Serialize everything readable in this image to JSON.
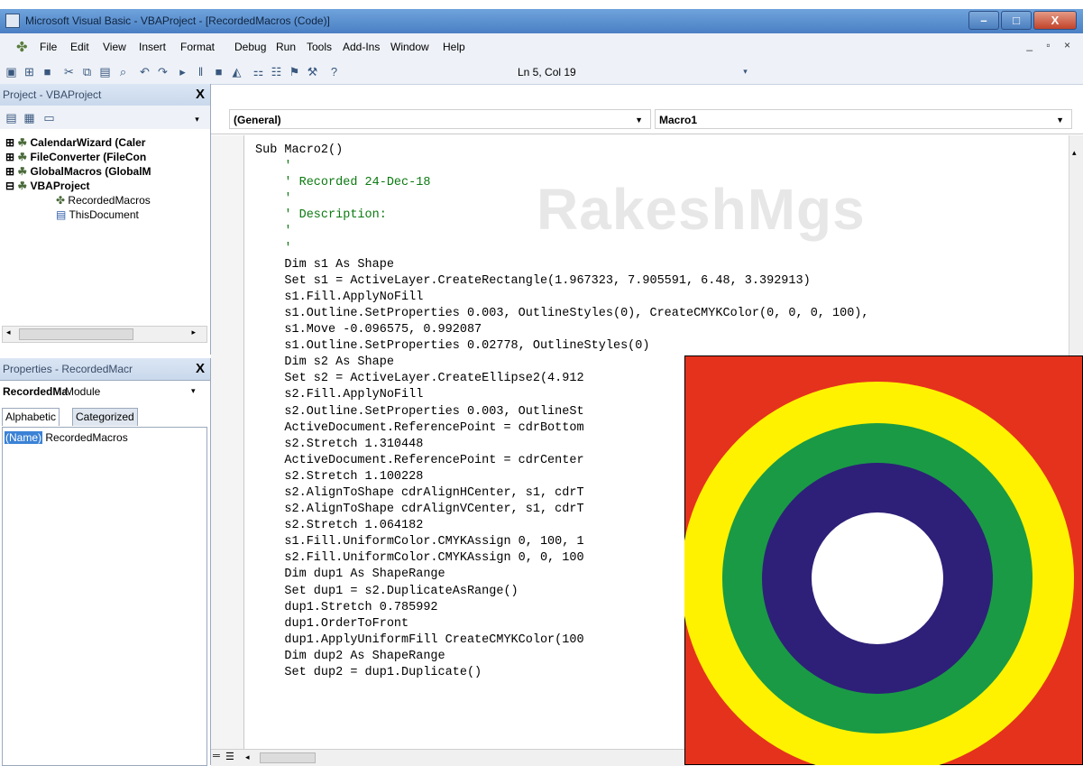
{
  "window": {
    "title": "Microsoft Visual Basic - VBAProject - [RecordedMacros (Code)]",
    "buttons": {
      "minimize": "–",
      "maximize": "□",
      "close": "X"
    }
  },
  "menu": {
    "items": [
      "File",
      "Edit",
      "View",
      "Insert",
      "Format",
      "Debug",
      "Run",
      "Tools",
      "Add-Ins",
      "Window",
      "Help"
    ],
    "mdi_controls": "_ ▫ ×"
  },
  "toolbar": {
    "cursor_position": "Ln 5, Col 19"
  },
  "project_explorer": {
    "title": "Project - VBAProject",
    "close": "X",
    "tree": [
      {
        "label": "CalendarWizard (Caler",
        "bold": true
      },
      {
        "label": "FileConverter (FileCon",
        "bold": true
      },
      {
        "label": "GlobalMacros (GlobalM",
        "bold": true
      },
      {
        "label": "VBAProject",
        "bold": true
      },
      {
        "label": "RecordedMacros",
        "bold": false
      },
      {
        "label": "ThisDocument",
        "bold": false
      }
    ]
  },
  "properties": {
    "title": "Properties - RecordedMacr",
    "close": "X",
    "object_name": "RecordedMa",
    "object_type": "Module",
    "tabs": [
      "Alphabetic",
      "Categorized"
    ],
    "rows": [
      {
        "name": "(Name)",
        "value": "RecordedMacros"
      }
    ]
  },
  "code_window": {
    "object_combo": "(General)",
    "procedure_combo": "Macro1",
    "watermark": "RakeshMgs",
    "lines": [
      {
        "text": "Sub Macro2()",
        "comment": false
      },
      {
        "text": "    '",
        "comment": true
      },
      {
        "text": "    ' Recorded 24-Dec-18",
        "comment": true
      },
      {
        "text": "    '",
        "comment": true
      },
      {
        "text": "    ' Description:",
        "comment": true
      },
      {
        "text": "    '",
        "comment": true
      },
      {
        "text": "    '",
        "comment": true
      },
      {
        "text": "    Dim s1 As Shape",
        "comment": false
      },
      {
        "text": "    Set s1 = ActiveLayer.CreateRectangle(1.967323, 7.905591, 6.48, 3.392913)",
        "comment": false
      },
      {
        "text": "    s1.Fill.ApplyNoFill",
        "comment": false
      },
      {
        "text": "    s1.Outline.SetProperties 0.003, OutlineStyles(0), CreateCMYKColor(0, 0, 0, 100),",
        "comment": false
      },
      {
        "text": "    s1.Move -0.096575, 0.992087",
        "comment": false
      },
      {
        "text": "    s1.Outline.SetProperties 0.02778, OutlineStyles(0)",
        "comment": false
      },
      {
        "text": "    Dim s2 As Shape",
        "comment": false
      },
      {
        "text": "    Set s2 = ActiveLayer.CreateEllipse2(4.912",
        "comment": false
      },
      {
        "text": "    s2.Fill.ApplyNoFill",
        "comment": false
      },
      {
        "text": "    s2.Outline.SetProperties 0.003, OutlineSt",
        "comment": false
      },
      {
        "text": "    ActiveDocument.ReferencePoint = cdrBottom",
        "comment": false
      },
      {
        "text": "    s2.Stretch 1.310448",
        "comment": false
      },
      {
        "text": "    ActiveDocument.ReferencePoint = cdrCenter",
        "comment": false
      },
      {
        "text": "    s2.Stretch 1.100228",
        "comment": false
      },
      {
        "text": "    s2.AlignToShape cdrAlignHCenter, s1, cdrT",
        "comment": false
      },
      {
        "text": "    s2.AlignToShape cdrAlignVCenter, s1, cdrT",
        "comment": false
      },
      {
        "text": "    s2.Stretch 1.064182",
        "comment": false
      },
      {
        "text": "    s1.Fill.UniformColor.CMYKAssign 0, 100, 1",
        "comment": false
      },
      {
        "text": "    s2.Fill.UniformColor.CMYKAssign 0, 0, 100",
        "comment": false
      },
      {
        "text": "    Dim dup1 As ShapeRange",
        "comment": false
      },
      {
        "text": "    Set dup1 = s2.DuplicateAsRange()",
        "comment": false
      },
      {
        "text": "    dup1.Stretch 0.785992",
        "comment": false
      },
      {
        "text": "    dup1.OrderToFront",
        "comment": false
      },
      {
        "text": "    dup1.ApplyUniformFill CreateCMYKColor(100",
        "comment": false
      },
      {
        "text": "    Dim dup2 As ShapeRange",
        "comment": false
      },
      {
        "text": "    Set dup2 = dup1.Duplicate()",
        "comment": false
      }
    ]
  },
  "artwork": {
    "colors": {
      "background": "#e5321d",
      "outer_ring": "#fff200",
      "middle_ring": "#1a9a45",
      "inner_ring": "#2e2078",
      "center": "#ffffff"
    }
  }
}
